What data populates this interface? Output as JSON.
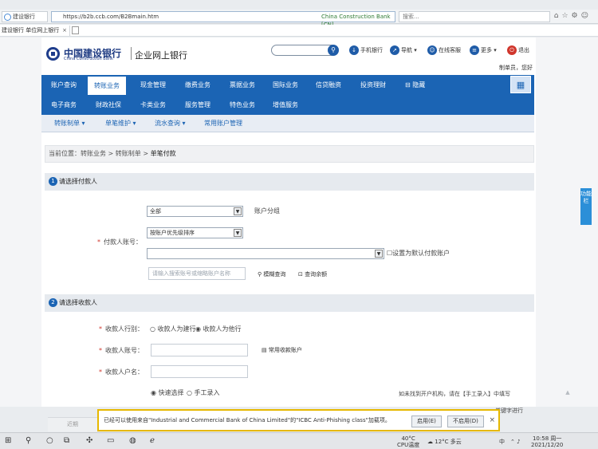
{
  "browser": {
    "site_label": "建设银行",
    "url": "https://b2b.ccb.com/B2Bmain.htm",
    "cert": "China Construction Bank [CN]",
    "search_placeholder": "搜索...",
    "tab_title": "建设银行 单位网上银行"
  },
  "header": {
    "logo_cn": "中国建设银行",
    "logo_en": "China Construction Bank",
    "product": "企业网上银行",
    "quick_links": [
      "手机银行",
      "导航",
      "在线客服",
      "更多",
      "退出"
    ],
    "welcome": "制单员，您好"
  },
  "nav": {
    "main": [
      "账户查询",
      "转账业务",
      "现金管理",
      "缴费业务",
      "票据业务",
      "国际业务",
      "信贷融资",
      "投资理财",
      "隐藏"
    ],
    "active": "转账业务",
    "second": [
      "电子商务",
      "财政社保",
      "卡类业务",
      "服务管理",
      "特色业务",
      "增值服务"
    ],
    "third": [
      "转账制单",
      "单笔维护",
      "流水查询",
      "常用账户管理"
    ]
  },
  "breadcrumb": {
    "prefix": "当前位置：转账业务 > 转账制单 > ",
    "current": "单笔付款"
  },
  "section1": {
    "num": "1",
    "title": "请选择付款人",
    "group_select": "全部",
    "group_label": "账户分组",
    "sort_select": "按账户优先级排序",
    "payer_label": "付款人账号：",
    "default_checkbox": "设置为默认付款账户",
    "filter_placeholder": "请输入搜索账号或缩略账户名称",
    "fuzzy_search": "模糊查询",
    "balance_query": "查询余额"
  },
  "section2": {
    "num": "2",
    "title": "请选择收款人",
    "bank_label": "收款人行别：",
    "bank_options": [
      "收款人为建行",
      "收款人为他行"
    ],
    "bank_selected": "收款人为他行",
    "account_label": "收款人账号：",
    "common_accounts": "常用收款账户",
    "name_label": "收款人户名：",
    "mode_options": [
      "快速选择",
      "手工录入"
    ],
    "mode_selected": "快速选择",
    "hint": "如未找到开户机构，请在【手工录入】中填写",
    "hint2": "关键字进行"
  },
  "side_tab": "功能栏",
  "notification": {
    "text": "已经可以使用来自\"Industrial and Commercial Bank of China Limited\"的\"ICBC Anti-Phishing class\"加载项。",
    "enable": "启用(E)",
    "disable": "不启用(D)"
  },
  "lower_strip": "近期",
  "taskbar": {
    "temp": "40°C",
    "cpu": "CPU温度",
    "weather": "12°C 多云",
    "lang": "中",
    "time": "10:58 周一",
    "date": "2021/12/20"
  }
}
